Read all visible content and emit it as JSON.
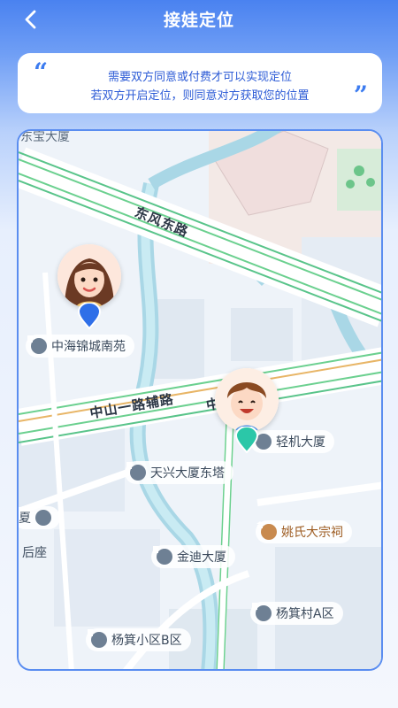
{
  "header": {
    "title": "接娃定位"
  },
  "notice": {
    "line1": "需要双方同意或付费才可以实现定位",
    "line2": "若双方开启定位，则同意对方获取您的位置"
  },
  "map": {
    "roads": {
      "dongfeng": "东风东路",
      "zhongshan": "中山一路辅路",
      "zhong_partial": "中"
    },
    "pois": {
      "zhonghai": "中海锦城南苑",
      "qingji": "轻机大厦",
      "tianxing": "天兴大厦东塔",
      "yao": "姚氏大宗祠",
      "jindi": "金迪大厦",
      "yangjicun": "杨箕村A区",
      "yangjixiaoqu": "杨箕小区B区",
      "top_left": "东宝大厦",
      "left_xia": "夏",
      "left_houzuo": "后座"
    },
    "markers": {
      "mother_pin_color": "#2f6fe8",
      "child_pin_color": "#2bc7a8"
    }
  }
}
